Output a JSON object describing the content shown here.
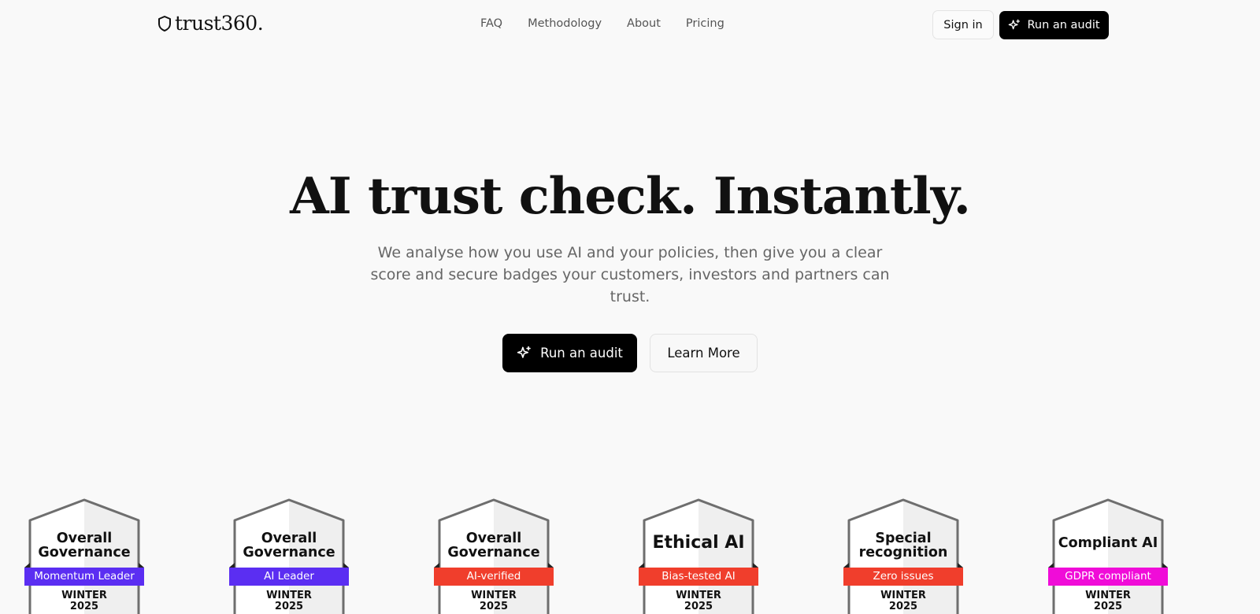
{
  "brand": {
    "logo_text": "trust360."
  },
  "nav": {
    "items": [
      "FAQ",
      "Methodology",
      "About",
      "Pricing"
    ]
  },
  "header": {
    "signin_label": "Sign in",
    "audit_label": "Run an audit"
  },
  "hero": {
    "title": "AI trust check. Instantly.",
    "subtitle": "We analyse how you use AI and your policies, then give you a clear score and secure badges your customers, investors and partners can trust.",
    "primary_label": "Run an audit",
    "secondary_label": "Learn More"
  },
  "badges": [
    {
      "title": "Overall Governance",
      "ribbon": "Momentum Leader",
      "ribbon_color": "#5b2ef2",
      "season": "WINTER",
      "year": "2025"
    },
    {
      "title": "Overall Governance",
      "ribbon": "AI Leader",
      "ribbon_color": "#5b2ef2",
      "season": "WINTER",
      "year": "2025"
    },
    {
      "title": "Overall Governance",
      "ribbon": "AI-verified",
      "ribbon_color": "#f03e2c",
      "season": "WINTER",
      "year": "2025"
    },
    {
      "title": "Ethical AI",
      "ribbon": "Bias-tested AI",
      "ribbon_color": "#f03e2c",
      "season": "WINTER",
      "year": "2025"
    },
    {
      "title": "Special recognition",
      "ribbon": "Zero issues",
      "ribbon_color": "#f03e2c",
      "season": "WINTER",
      "year": "2025"
    },
    {
      "title": "Compliant AI",
      "ribbon": "GDPR compliant",
      "ribbon_color": "#f00cd8",
      "season": "WINTER",
      "year": "2025"
    }
  ],
  "colors": {
    "primary": "#000000",
    "background": "#f9f9f9",
    "muted_text": "#666666"
  },
  "icons": {
    "logo": "shield-icon",
    "audit": "sparkles-icon"
  }
}
